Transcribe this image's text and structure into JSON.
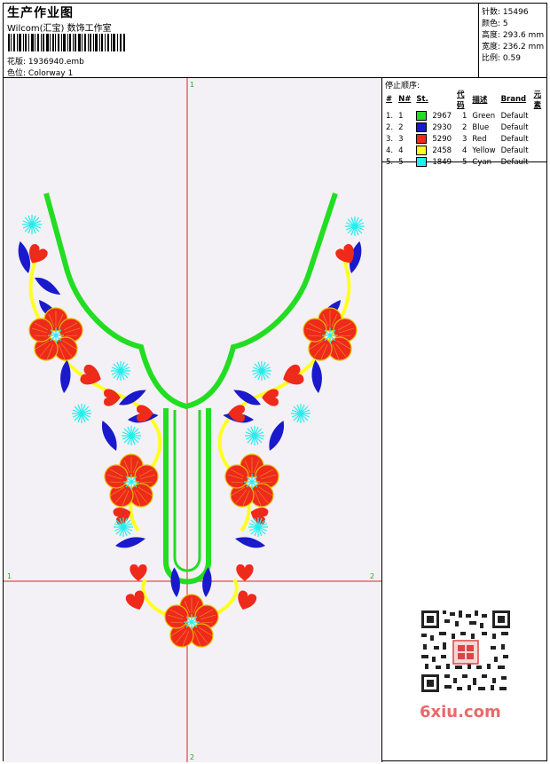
{
  "header": {
    "title": "生产作业图",
    "subtitle": "Wilcom(汇宝) 数饰工作室",
    "pattern_label": "花版:",
    "pattern_value": "1936940.emb",
    "colorway_label": "色位:",
    "colorway_value": "Colorway 1"
  },
  "stats": [
    {
      "label": "针数:",
      "value": "15496"
    },
    {
      "label": "颜色:",
      "value": "5"
    },
    {
      "label": "高度:",
      "value": "293.6 mm"
    },
    {
      "label": "宽度:",
      "value": "236.2 mm"
    },
    {
      "label": "比例:",
      "value": "0.59"
    }
  ],
  "stop_sequence": {
    "title": "停止顺序:",
    "headers": [
      "#",
      "N#",
      "St.",
      "代码",
      "描述",
      "Brand",
      "元素"
    ],
    "rows": [
      {
        "num": "1.",
        "n": "1",
        "color": "#22dd22",
        "st": "2967",
        "code": "1",
        "desc": "Green",
        "brand": "Default"
      },
      {
        "num": "2.",
        "n": "2",
        "color": "#1a1acc",
        "st": "2930",
        "code": "2",
        "desc": "Blue",
        "brand": "Default"
      },
      {
        "num": "3.",
        "n": "3",
        "color": "#ee2a1a",
        "st": "5290",
        "code": "3",
        "desc": "Red",
        "brand": "Default"
      },
      {
        "num": "4.",
        "n": "4",
        "color": "#ffff22",
        "st": "2458",
        "code": "4",
        "desc": "Yellow",
        "brand": "Default"
      },
      {
        "num": "5.",
        "n": "5",
        "color": "#22eeee",
        "st": "1849",
        "code": "5",
        "desc": "Cyan",
        "brand": "Default"
      }
    ]
  },
  "guides": {
    "top": "1",
    "bottom": "2",
    "left": "1",
    "right": "2"
  },
  "watermark": "6xiu.com",
  "colors": {
    "green": "#22dd22",
    "blue": "#1a1acc",
    "red": "#ee2a1a",
    "yellow": "#ffff22",
    "cyan": "#22eeee",
    "guide": "#dd2222"
  }
}
